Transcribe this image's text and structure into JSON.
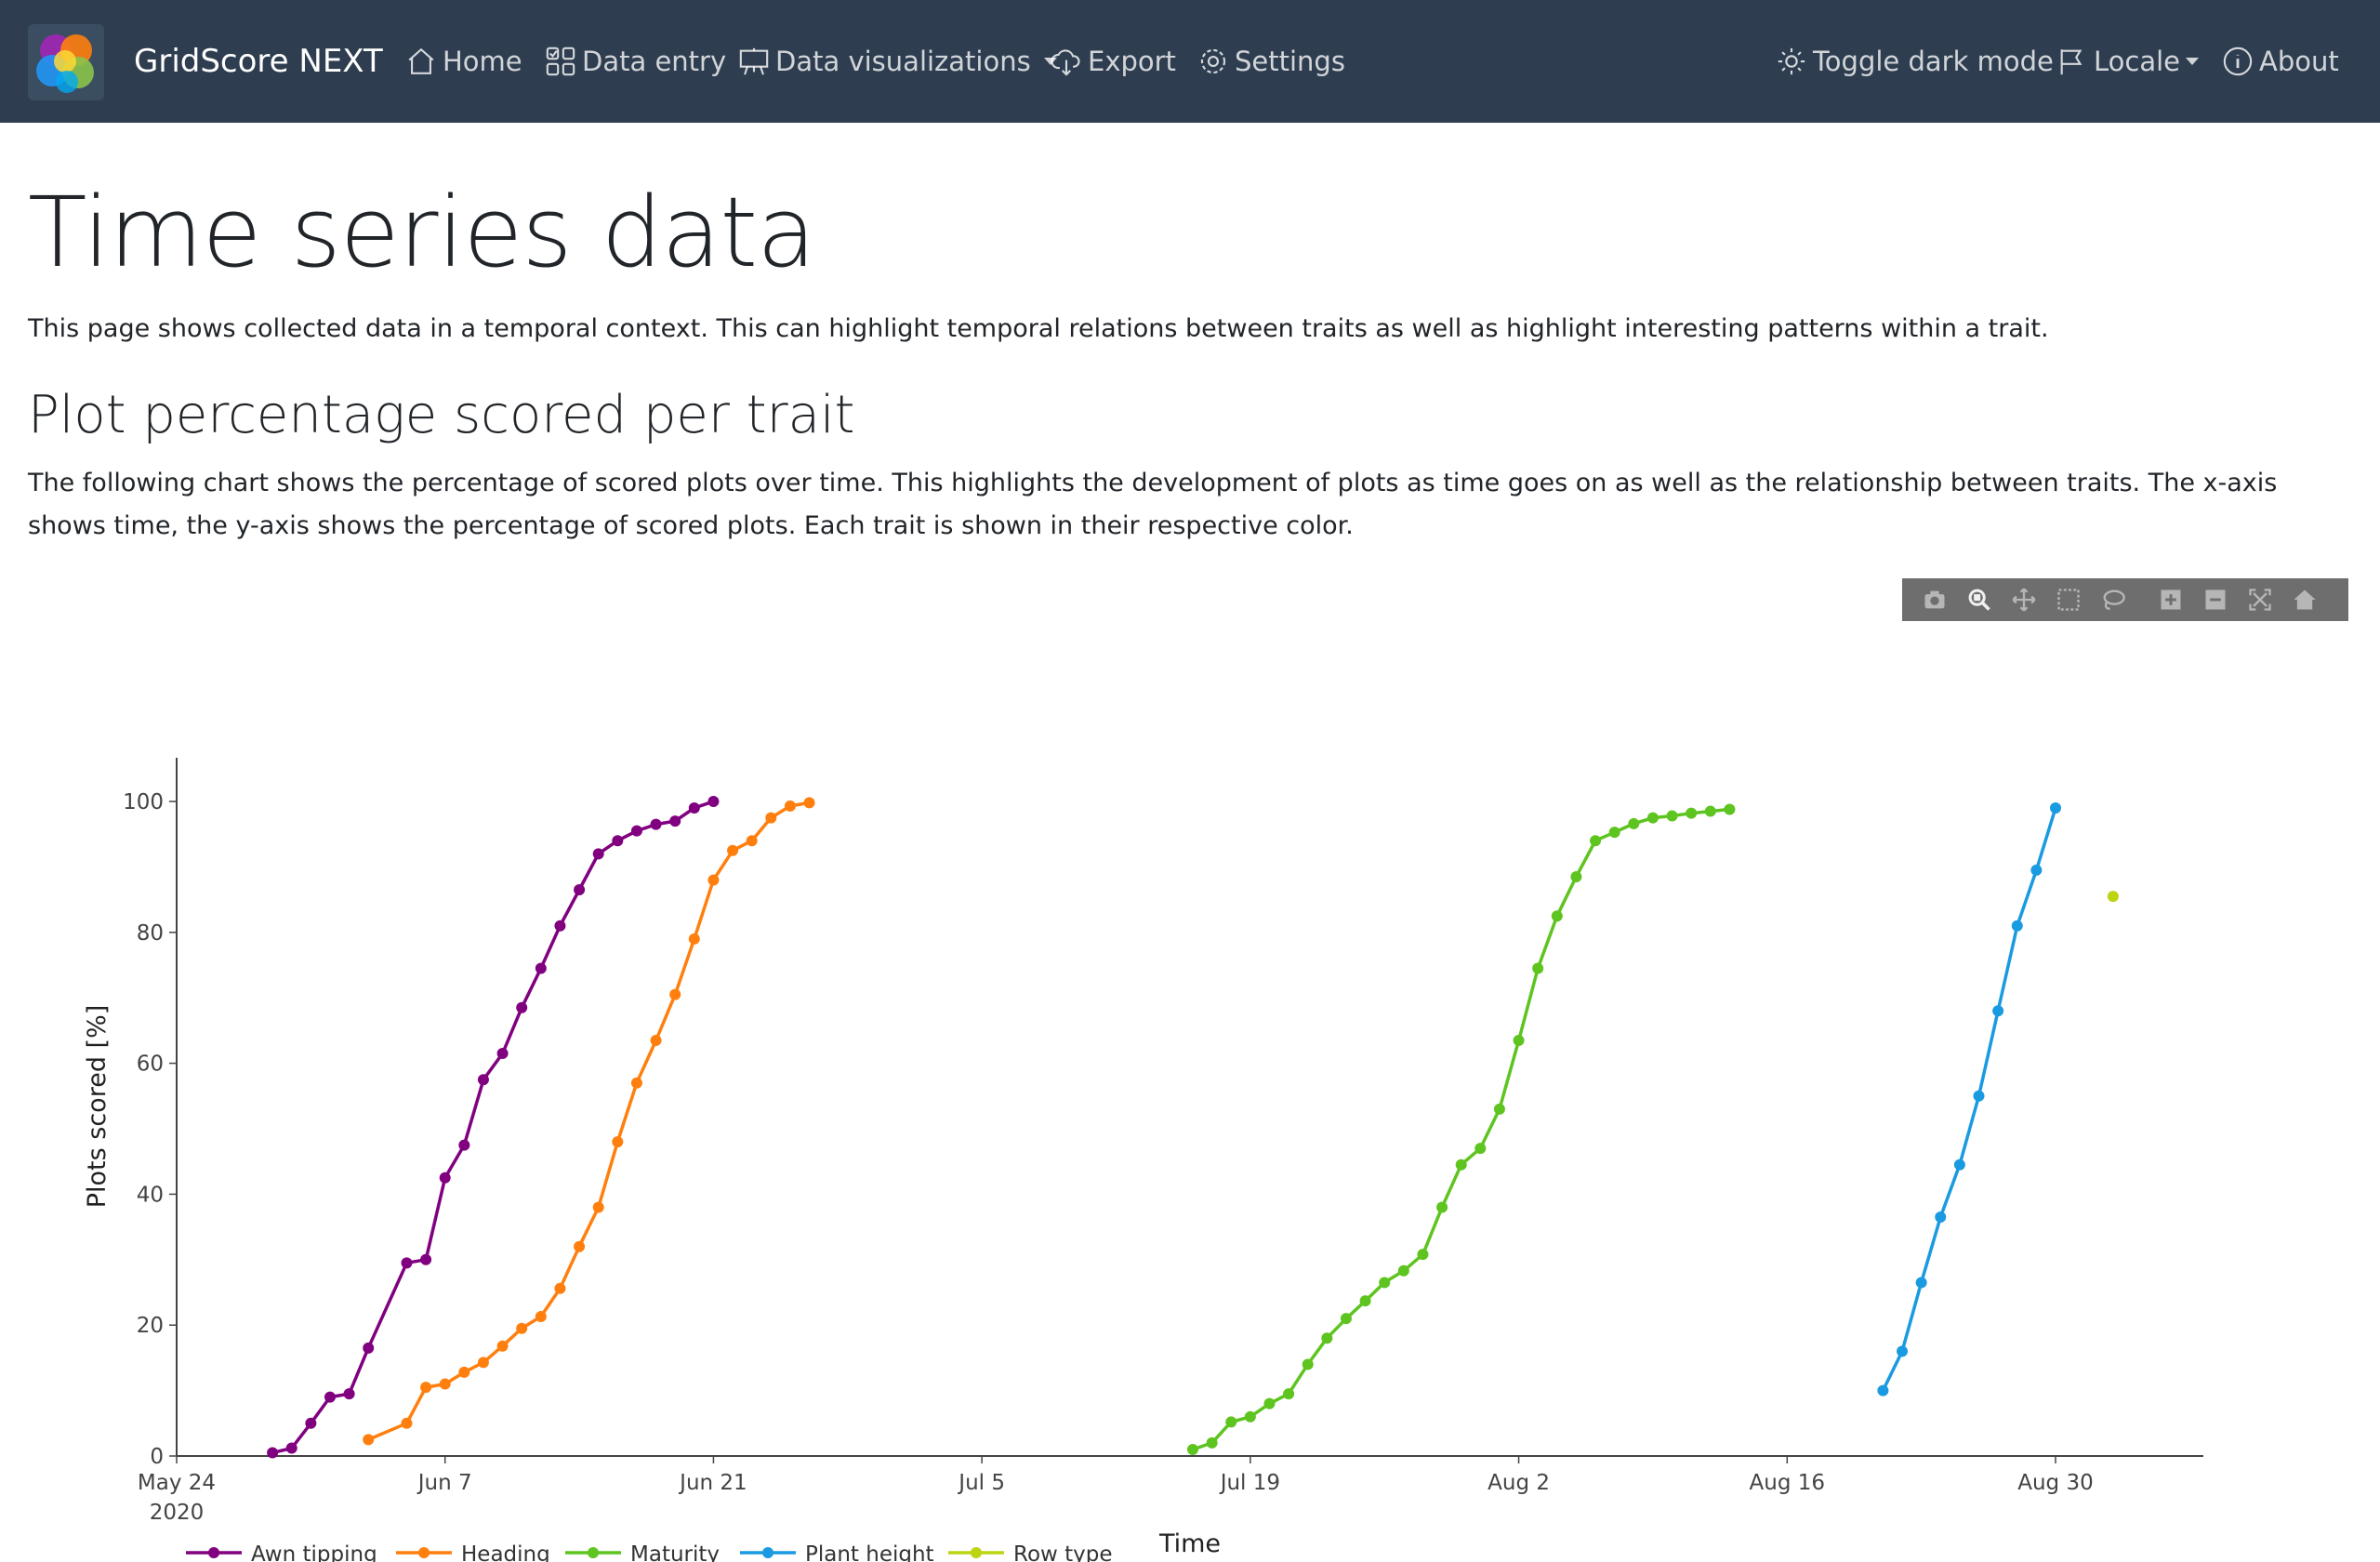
{
  "app": {
    "brand": "GridScore NEXT"
  },
  "nav": {
    "home": "Home",
    "data_entry": "Data entry",
    "data_visualizations": "Data visualizations",
    "export": "Export",
    "settings": "Settings",
    "toggle_dark_mode": "Toggle dark mode",
    "locale": "Locale",
    "about": "About"
  },
  "page": {
    "title": "Time series data",
    "lead": "This page shows collected data in a temporal context. This can highlight temporal relations between traits as well as highlight interesting patterns within a trait.",
    "section_title": "Plot percentage scored per trait",
    "section_text": "The following chart shows the percentage of scored plots over time. This highlights the development of plots as time goes on as well as the relationship between traits. The x-axis shows time, the y-axis shows the percentage of scored plots. Each trait is shown in their respective color."
  },
  "modebar": {
    "icons": [
      "camera-icon",
      "zoom-icon",
      "pan-icon",
      "box-select-icon",
      "lasso-select-icon",
      "zoom-in-icon",
      "zoom-out-icon",
      "autoscale-icon",
      "reset-axes-icon"
    ]
  },
  "chart_data": {
    "type": "line",
    "xlabel": "Time",
    "ylabel": "Plots scored [%]",
    "xlim": [
      "2020-05-24",
      "2020-09-14"
    ],
    "ylim": [
      0,
      105
    ],
    "x_ticks": [
      "2020-05-24",
      "2020-06-07",
      "2020-06-21",
      "2020-07-05",
      "2020-07-19",
      "2020-08-02",
      "2020-08-16",
      "2020-08-30"
    ],
    "x_tick_labels": [
      "May 24",
      "Jun 7",
      "Jun 21",
      "Jul 5",
      "Jul 19",
      "Aug 2",
      "Aug 16",
      "Aug 30"
    ],
    "x_tick_year_label": "2020",
    "y_ticks": [
      0,
      20,
      40,
      60,
      80,
      100
    ],
    "grid": false,
    "legend_position": "bottom-left",
    "series": [
      {
        "name": "Awn tipping",
        "color": "#800080",
        "x": [
          "2020-05-29",
          "2020-05-30",
          "2020-05-31",
          "2020-06-01",
          "2020-06-02",
          "2020-06-03",
          "2020-06-05",
          "2020-06-06",
          "2020-06-07",
          "2020-06-08",
          "2020-06-09",
          "2020-06-10",
          "2020-06-11",
          "2020-06-12",
          "2020-06-13",
          "2020-06-14",
          "2020-06-15",
          "2020-06-16",
          "2020-06-17",
          "2020-06-18",
          "2020-06-19",
          "2020-06-20",
          "2020-06-21"
        ],
        "y": [
          0.5,
          1.2,
          5,
          9,
          9.5,
          16.5,
          29.5,
          30,
          42.5,
          47.5,
          57.5,
          61.5,
          68.5,
          74.5,
          81,
          86.5,
          92,
          94,
          95.5,
          96.5,
          97,
          99,
          100
        ]
      },
      {
        "name": "Heading",
        "color": "#ff7f0e",
        "x": [
          "2020-06-03",
          "2020-06-05",
          "2020-06-06",
          "2020-06-07",
          "2020-06-08",
          "2020-06-09",
          "2020-06-10",
          "2020-06-11",
          "2020-06-12",
          "2020-06-13",
          "2020-06-14",
          "2020-06-15",
          "2020-06-16",
          "2020-06-17",
          "2020-06-18",
          "2020-06-19",
          "2020-06-20",
          "2020-06-21",
          "2020-06-22",
          "2020-06-23",
          "2020-06-24",
          "2020-06-25",
          "2020-06-26"
        ],
        "y": [
          2.5,
          5,
          10.5,
          11,
          12.8,
          14.3,
          16.8,
          19.5,
          21.3,
          25.6,
          32,
          38,
          48,
          57,
          63.5,
          70.5,
          79,
          88,
          92.5,
          94,
          97.5,
          99.3,
          99.8
        ]
      },
      {
        "name": "Maturity",
        "color": "#5ec41f",
        "x": [
          "2020-07-16",
          "2020-07-17",
          "2020-07-18",
          "2020-07-19",
          "2020-07-20",
          "2020-07-21",
          "2020-07-22",
          "2020-07-23",
          "2020-07-24",
          "2020-07-25",
          "2020-07-26",
          "2020-07-27",
          "2020-07-28",
          "2020-07-29",
          "2020-07-30",
          "2020-07-31",
          "2020-08-01",
          "2020-08-02",
          "2020-08-03",
          "2020-08-04",
          "2020-08-05",
          "2020-08-06",
          "2020-08-07",
          "2020-08-08",
          "2020-08-09",
          "2020-08-10",
          "2020-08-11",
          "2020-08-12",
          "2020-08-13"
        ],
        "y": [
          1,
          2,
          5.2,
          6,
          8,
          9.5,
          14,
          18,
          21,
          23.7,
          26.5,
          28.3,
          30.8,
          38,
          44.5,
          47,
          53,
          63.5,
          74.5,
          82.5,
          88.5,
          94,
          95.3,
          96.6,
          97.5,
          97.8,
          98.2,
          98.5,
          98.8
        ]
      },
      {
        "name": "Plant height",
        "color": "#1a9ae0",
        "x": [
          "2020-08-21",
          "2020-08-22",
          "2020-08-23",
          "2020-08-24",
          "2020-08-25",
          "2020-08-26",
          "2020-08-27",
          "2020-08-28",
          "2020-08-29",
          "2020-08-30"
        ],
        "y": [
          10,
          16,
          26.5,
          36.5,
          44.5,
          55,
          68,
          81,
          89.5,
          99
        ]
      },
      {
        "name": "Row type",
        "color": "#bcd411",
        "x": [
          "2020-09-02"
        ],
        "y": [
          85.5
        ]
      }
    ]
  }
}
